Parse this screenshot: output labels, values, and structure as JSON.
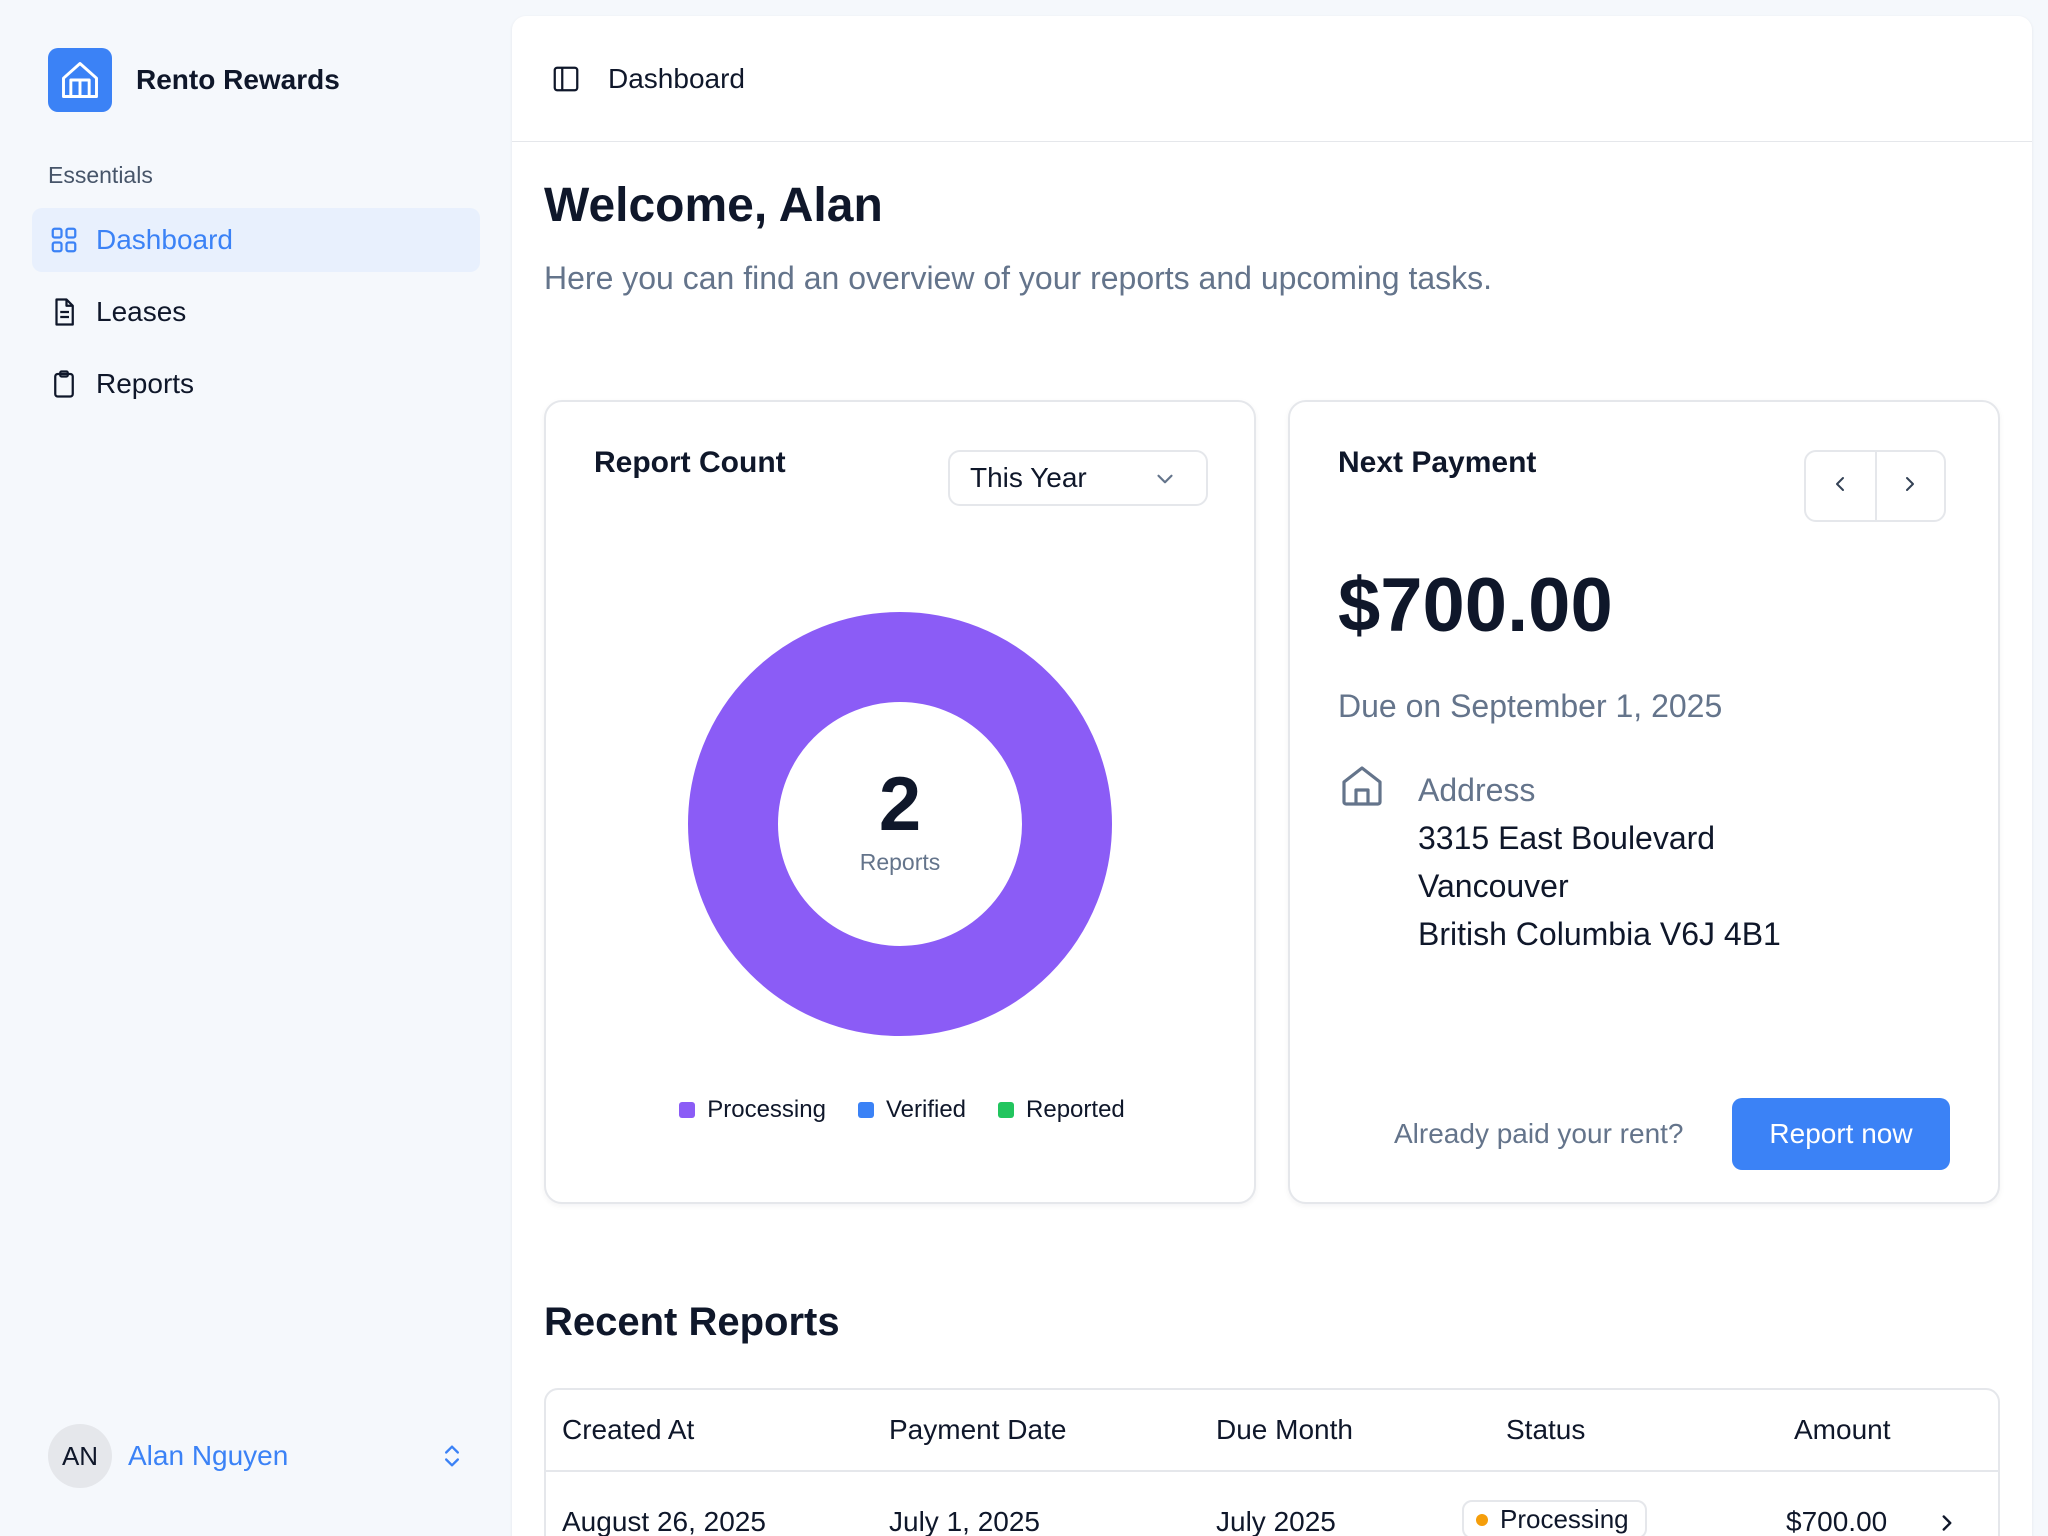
{
  "app": {
    "name": "Rento Rewards",
    "logo_icon": "home-icon",
    "brand_color": "#3b82f6"
  },
  "sidebar": {
    "section_label": "Essentials",
    "items": [
      {
        "label": "Dashboard",
        "icon": "grid-icon",
        "active": true
      },
      {
        "label": "Leases",
        "icon": "document-icon",
        "active": false
      },
      {
        "label": "Reports",
        "icon": "clipboard-icon",
        "active": false
      }
    ],
    "user": {
      "initials": "AN",
      "name": "Alan Nguyen",
      "toggle_icon": "chevrons-up-down-icon"
    }
  },
  "topbar": {
    "toggle_icon": "sidebar-toggle-icon",
    "breadcrumb": "Dashboard"
  },
  "page": {
    "title": "Welcome, Alan",
    "subtitle": "Here you can find an overview of your reports and upcoming tasks."
  },
  "report_count": {
    "title": "Report Count",
    "period_selected": "This Year",
    "total": "2",
    "total_label": "Reports",
    "legend": [
      {
        "label": "Processing",
        "color": "#8b5cf6"
      },
      {
        "label": "Verified",
        "color": "#3b82f6"
      },
      {
        "label": "Reported",
        "color": "#22c55e"
      }
    ]
  },
  "chart_data": {
    "type": "pie",
    "donut": true,
    "categories": [
      "Processing",
      "Verified",
      "Reported"
    ],
    "values": [
      2,
      0,
      0
    ],
    "colors": [
      "#8b5cf6",
      "#3b82f6",
      "#22c55e"
    ],
    "center_value": 2,
    "center_label": "Reports",
    "legend": "bottom"
  },
  "next_payment": {
    "title": "Next Payment",
    "amount": "$700.00",
    "due": "Due on September 1, 2025",
    "address_label": "Address",
    "address_line1": "3315 East Boulevard",
    "address_line2": "Vancouver",
    "address_line3": "British Columbia V6J 4B1",
    "paid_question": "Already paid your rent?",
    "report_button": "Report now"
  },
  "recent_reports": {
    "title": "Recent Reports",
    "columns": [
      "Created At",
      "Payment Date",
      "Due Month",
      "Status",
      "Amount"
    ],
    "rows": [
      {
        "created_at": "August 26, 2025",
        "payment_date": "July 1, 2025",
        "due_month": "July 2025",
        "status": "Processing",
        "status_color": "#f59e0b",
        "amount": "$700.00"
      }
    ]
  }
}
